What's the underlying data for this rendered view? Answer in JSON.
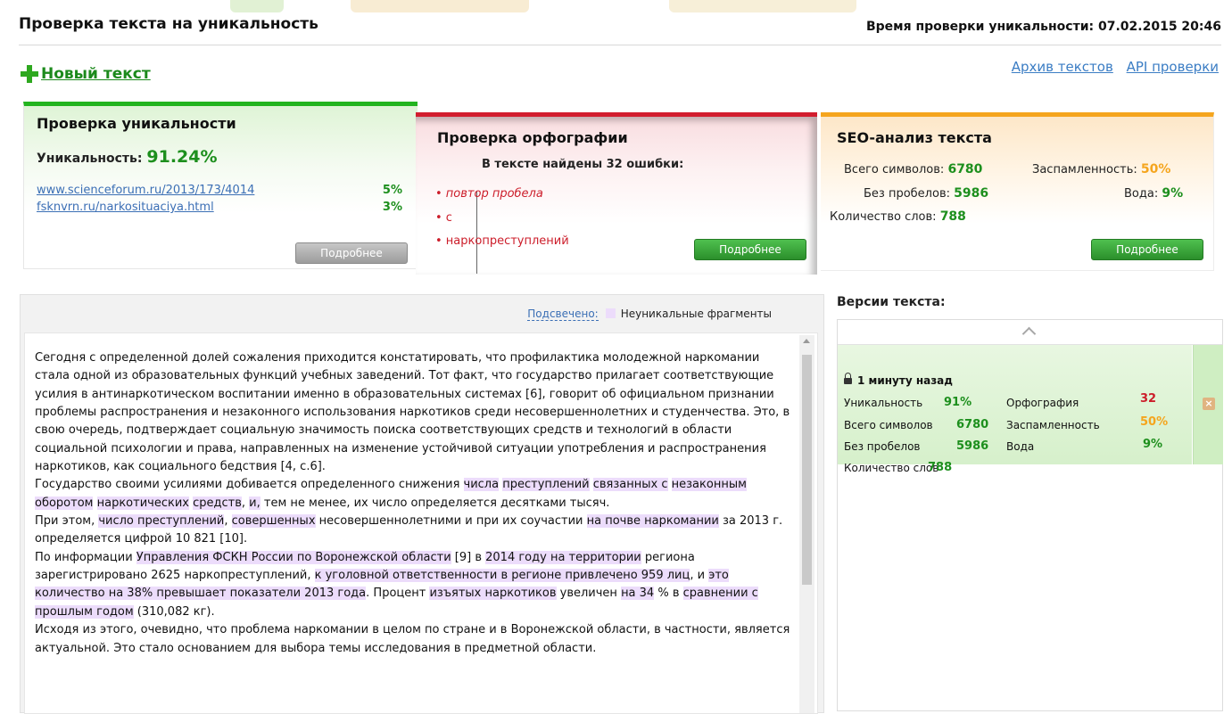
{
  "header": {
    "title": "Проверка текста на уникальность",
    "check_time": "Время проверки уникальности: 07.02.2015 20:46"
  },
  "actions": {
    "new_text": "Новый текст",
    "archive": "Архив текстов",
    "api": "API проверки"
  },
  "uniqueness_panel": {
    "title": "Проверка уникальности",
    "label": "Уникальность:",
    "value": "91.24%",
    "sources": [
      {
        "url": "www.scienceforum.ru/2013/173/4014",
        "percent": "5%"
      },
      {
        "url": "fsknvrn.ru/narkosituaciya.html",
        "percent": "3%"
      }
    ],
    "more": "Подробнее"
  },
  "spelling_panel": {
    "title": "Проверка орфографии",
    "summary": "В тексте найдены 32 ошибки:",
    "errors": [
      "• повтор пробела",
      "• с",
      "• наркопреступлений"
    ],
    "more": "Подробнее"
  },
  "seo_panel": {
    "title": "SEO-анализ текста",
    "chars_label": "Всего символов:",
    "chars": "6780",
    "spam_label": "Заспамленность:",
    "spam": "50%",
    "nospace_label": "Без пробелов:",
    "nospace": "5986",
    "water_label": "Вода:",
    "water": "9%",
    "words_label": "Количество слов:",
    "words": "788",
    "more": "Подробнее"
  },
  "text_area": {
    "highlight_label": "Подсвечено:",
    "highlight_legend": "Неуникальные фрагменты"
  },
  "versions": {
    "title": "Версии текста:",
    "item": {
      "time": "1 минуту назад",
      "uniq_label": "Уникальность",
      "uniq": "91%",
      "spell_label": "Орфография",
      "spell": "32",
      "chars_label": "Всего символов",
      "chars": "6780",
      "spam_label": "Заспамленность",
      "spam": "50%",
      "nospace_label": "Без пробелов",
      "nospace": "5986",
      "water_label": "Вода",
      "water": "9%",
      "words_label": "Количество слов",
      "words": "788",
      "delete": "×"
    }
  },
  "colors": {
    "green": "#1d8f1d",
    "red": "#cc1d2a",
    "orange": "#f5a51d",
    "highlight": "#ecdcfb",
    "link": "#3b6fb5"
  }
}
